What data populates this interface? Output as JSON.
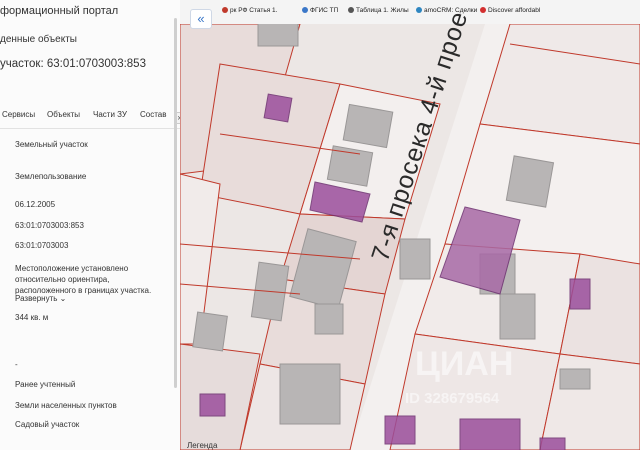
{
  "panel": {
    "portal_title": "формационный портал",
    "objects_link": "денные объекты",
    "parcel_header": "участок: 63:01:0703003:853",
    "tabs": [
      "Сервисы",
      "Объекты",
      "Части ЗУ",
      "Состав"
    ],
    "tab_next": "›",
    "fields": {
      "type": "Земельный участок",
      "usage": "Землепользование",
      "date": "06.12.2005",
      "cad_number": "63:01:0703003:853",
      "block": "63:01:0703003",
      "location_1": "Местоположение установлено",
      "location_2": "относительно ориентира,",
      "location_3": "расположенного в границах участка.",
      "expand": "Развернуть",
      "area": "344 кв. м",
      "dash": "-",
      "status": "Ранее учтенный",
      "category": "Земли населенных пунктов",
      "permitted_use": "Садовый участок"
    }
  },
  "browser": {
    "bookmarks": [
      "рк РФ Статья 1.",
      "ФГИС ТП",
      "Таблица 1. Жилы",
      "amoCRM: Сделки",
      "Discover affordabl"
    ]
  },
  "map": {
    "collapse_icon": "«",
    "road_label": "7-я просека 4-й прое",
    "watermark": "ЦИАН",
    "watermark_id": "ID 328679564",
    "legend": "Легенда"
  },
  "colors": {
    "accent": "#3a77c8",
    "boundary": "#c0392b",
    "building": "#b3b3b3",
    "parcel_fill": "#8d3f8f"
  }
}
